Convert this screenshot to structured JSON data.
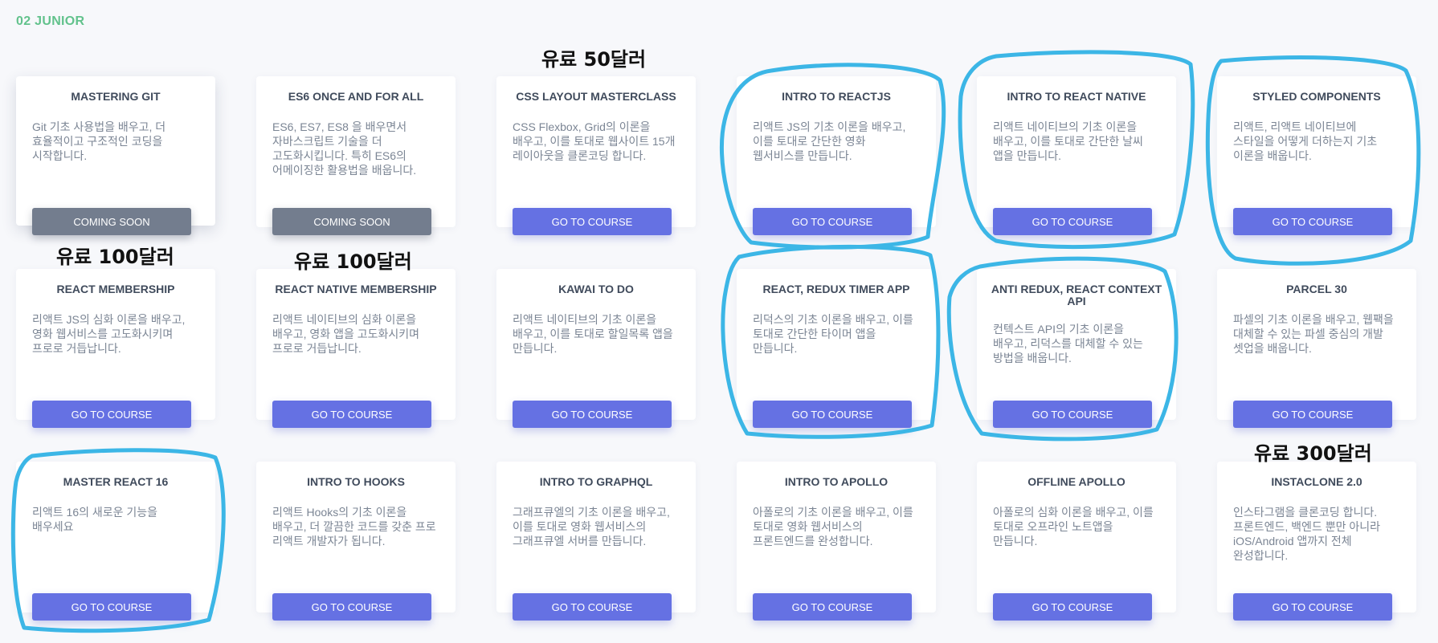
{
  "section": {
    "label": "02 JUNIOR"
  },
  "courses": [
    {
      "title": "MASTERING GIT",
      "desc": "Git 기초 사용법을 배우고, 더 효율적이고 구조적인 코딩을 시작합니다.",
      "button": "COMING SOON",
      "status": "coming-soon"
    },
    {
      "title": "ES6 ONCE AND FOR ALL",
      "desc": "ES6, ES7, ES8 을 배우면서 자바스크립트 기술을 더 고도화시킵니다. 특히 ES6의 어메이징한 활용법을 배웁니다.",
      "button": "COMING SOON",
      "status": "coming-soon"
    },
    {
      "title": "CSS LAYOUT MASTERCLASS",
      "desc": "CSS Flexbox, Grid의 이론을 배우고, 이를 토대로 웹사이트 15개 레이아웃을 클론코딩 합니다.",
      "button": "GO TO COURSE",
      "status": "available"
    },
    {
      "title": "INTRO TO REACTJS",
      "desc": "리액트 JS의 기초 이론을 배우고, 이를 토대로 간단한 영화 웹서비스를 만듭니다.",
      "button": "GO TO COURSE",
      "status": "available"
    },
    {
      "title": "INTRO TO REACT NATIVE",
      "desc": "리액트 네이티브의 기초 이론을 배우고, 이를 토대로 간단한 날씨 앱을 만듭니다.",
      "button": "GO TO COURSE",
      "status": "available"
    },
    {
      "title": "STYLED COMPONENTS",
      "desc": "리액트, 리액트 네이티브에 스타일을 어떻게 더하는지 기초 이론을 배웁니다.",
      "button": "GO TO COURSE",
      "status": "available"
    },
    {
      "title": "REACT MEMBERSHIP",
      "desc": "리액트 JS의 심화 이론을 배우고, 영화 웹서비스를 고도화시키며 프로로 거듭납니다.",
      "button": "GO TO COURSE",
      "status": "available"
    },
    {
      "title": "REACT NATIVE MEMBERSHIP",
      "desc": "리액트 네이티브의 심화 이론을 배우고, 영화 앱을 고도화시키며 프로로 거듭납니다.",
      "button": "GO TO COURSE",
      "status": "available"
    },
    {
      "title": "KAWAI TO DO",
      "desc": "리액트 네이티브의 기초 이론을 배우고, 이를 토대로 할일목록 앱을 만듭니다.",
      "button": "GO TO COURSE",
      "status": "available"
    },
    {
      "title": "REACT, REDUX TIMER APP",
      "desc": "리덕스의 기초 이론을 배우고, 이를 토대로 간단한 타이머 앱을 만듭니다.",
      "button": "GO TO COURSE",
      "status": "available"
    },
    {
      "title": "ANTI REDUX, REACT CONTEXT API",
      "desc": "컨텍스트 API의 기초 이론을 배우고, 리덕스를 대체할 수 있는 방법을 배웁니다.",
      "button": "GO TO COURSE",
      "status": "available"
    },
    {
      "title": "PARCEL 30",
      "desc": "파셀의 기초 이론을 배우고, 웹팩을 대체할 수 있는 파셀 중심의 개발 셋업을 배웁니다.",
      "button": "GO TO COURSE",
      "status": "available"
    },
    {
      "title": "MASTER REACT 16",
      "desc": "리액트 16의 새로운 기능을 배우세요",
      "button": "GO TO COURSE",
      "status": "available"
    },
    {
      "title": "INTRO TO HOOKS",
      "desc": "리액트 Hooks의 기초 이론을 배우고, 더 깔끔한 코드를 갖춘 프로 리액트 개발자가 됩니다.",
      "button": "GO TO COURSE",
      "status": "available"
    },
    {
      "title": "INTRO TO GRAPHQL",
      "desc": "그래프큐엘의 기초 이론을 배우고, 이를 토대로 영화 웹서비스의 그래프큐엘 서버를 만듭니다.",
      "button": "GO TO COURSE",
      "status": "available"
    },
    {
      "title": "INTRO TO APOLLO",
      "desc": "아폴로의 기초 이론을 배우고, 이를 토대로 영화 웹서비스의 프론트엔드를 완성합니다.",
      "button": "GO TO COURSE",
      "status": "available"
    },
    {
      "title": "OFFLINE APOLLO",
      "desc": "아폴로의 심화 이론을 배우고, 이를 토대로 오프라인 노트앱을 만듭니다.",
      "button": "GO TO COURSE",
      "status": "available"
    },
    {
      "title": "INSTACLONE 2.0",
      "desc": "인스타그램을 클론코딩 합니다. 프론트엔드, 백엔드 뿐만 아니라 iOS/Android 앱까지 전체 완성합니다.",
      "button": "GO TO COURSE",
      "status": "available"
    }
  ],
  "annotations": {
    "price_50": "유료 50달러",
    "price_100_a": "유료 100달러",
    "price_100_b": "유료 100달러",
    "price_300": "유료 300달러",
    "circle_color": "#3cb6e6"
  },
  "colors": {
    "accent": "#6571e3",
    "coming_soon": "#737d8e",
    "section_label": "#62c28c",
    "background": "#f7f8fb"
  }
}
